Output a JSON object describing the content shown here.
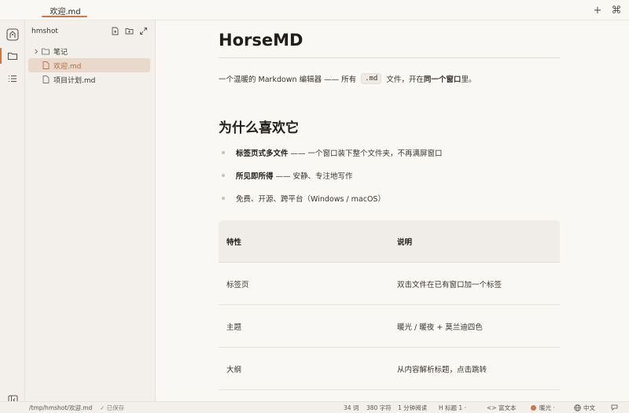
{
  "tabbar": {
    "active_tab": "欢迎.md",
    "new_tab": "+",
    "shortcut": "⌘"
  },
  "sidebar": {
    "title": "hmshot",
    "tree": [
      {
        "label": "笔记",
        "type": "folder"
      },
      {
        "label": "欢迎.md",
        "type": "file",
        "selected": true
      },
      {
        "label": "项目计划.md",
        "type": "file"
      }
    ]
  },
  "document": {
    "title": "HorseMD",
    "intro_before": "一个温暖的 Markdown 编辑器 —— 所有",
    "intro_code": ".md",
    "intro_middle": "文件，开在",
    "intro_bold": "同一个窗口",
    "intro_after": "里。",
    "h2": "为什么喜欢它",
    "bullets": [
      {
        "bold": "标签页式多文件",
        "text": " —— 一个窗口装下整个文件夹，不再满屏窗口"
      },
      {
        "bold": "所见即所得",
        "text": " —— 安静、专注地写作"
      },
      {
        "bold": "",
        "text": "免费、开源、跨平台（Windows / macOS）"
      }
    ],
    "table": {
      "headers": [
        "特性",
        "说明"
      ],
      "rows": [
        [
          "标签页",
          "双击文件在已有窗口加一个标签"
        ],
        [
          "主题",
          "暖光 / 暖夜 + 莫兰迪四色"
        ],
        [
          "大纲",
          "从内容解析标题，点击跳转"
        ]
      ]
    }
  },
  "statusbar": {
    "path": "/tmp/hmshot/欢迎.md",
    "saved": "✓ 已保存",
    "words": "34 词",
    "chars": "380 字符",
    "read_time": "1 分钟阅读",
    "heading": "H  标题 1 ·",
    "mode": "<> 富文本",
    "theme": "暖光 ·",
    "language": "中文",
    "accent_color": "#c9784a"
  }
}
